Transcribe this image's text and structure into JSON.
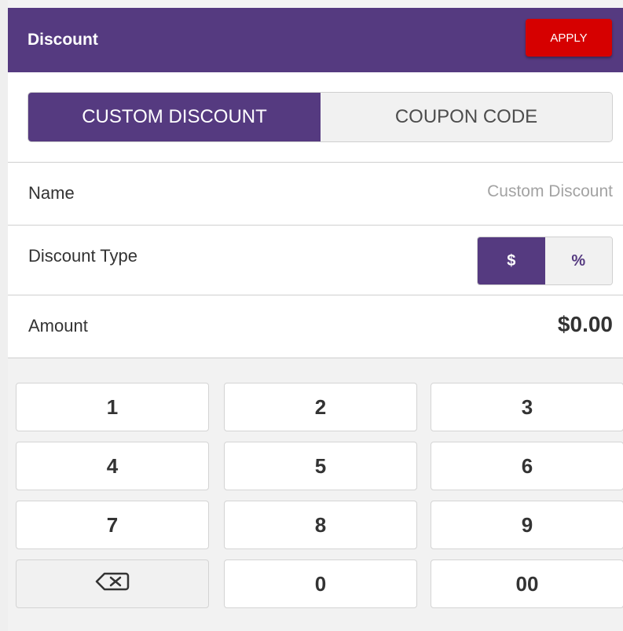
{
  "header": {
    "title": "Discount",
    "apply_label": "APPLY"
  },
  "tabs": {
    "custom_label": "CUSTOM DISCOUNT",
    "coupon_label": "COUPON CODE",
    "selected": "CUSTOM DISCOUNT"
  },
  "fields": {
    "name_label": "Name",
    "name_placeholder": "Custom Discount",
    "type_label": "Discount Type",
    "type_options": [
      "$",
      "%"
    ],
    "type_selected": "$",
    "amount_label": "Amount",
    "amount_value": "$0.00"
  },
  "keypad": {
    "keys": [
      "1",
      "2",
      "3",
      "4",
      "5",
      "6",
      "7",
      "8",
      "9",
      "0",
      "00"
    ],
    "backspace_icon": "backspace-icon"
  },
  "colors": {
    "brand": "#553a80",
    "apply": "#d60000"
  }
}
